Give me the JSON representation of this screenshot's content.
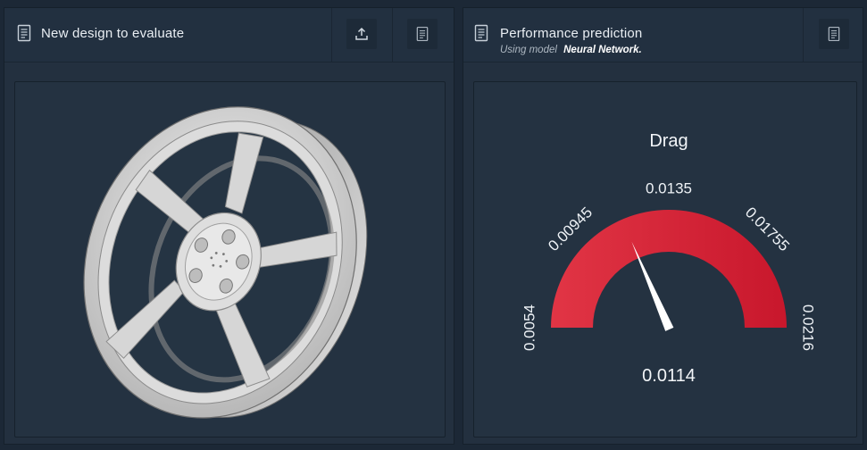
{
  "left_panel": {
    "title": "New design to evaluate",
    "upload_button": "upload-icon",
    "notes_button": "document-icon"
  },
  "right_panel": {
    "title": "Performance prediction",
    "subtitle_prefix": "Using model",
    "model_name": "Neural Network.",
    "notes_button": "document-icon"
  },
  "gauge": {
    "title": "Drag",
    "min_label": "0.0054",
    "max_label": "0.0216",
    "ticks": [
      "0.0054",
      "0.00945",
      "0.0135",
      "0.01755",
      "0.0216"
    ],
    "min": 0.0054,
    "max": 0.0216,
    "value": 0.0114,
    "value_label": "0.0114",
    "fill_color": "#d8283a"
  },
  "colors": {
    "background": "#1c2836",
    "panel": "#23303f",
    "gauge_fill": "#d8283a",
    "needle": "#ffffff"
  }
}
